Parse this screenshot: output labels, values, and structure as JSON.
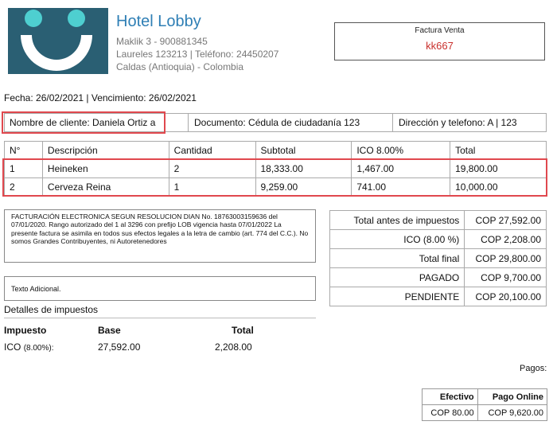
{
  "hotel": {
    "name": "Hotel Lobby",
    "address_line1": "Maklik 3 - 900881345",
    "address_line2": "Laureles 123213 | Teléfono: 24450207",
    "address_line3": "Caldas (Antioquia) - Colombia"
  },
  "invoice": {
    "label": "Factura Venta",
    "number": "kk667"
  },
  "dates": "Fecha: 26/02/2021 | Vencimiento: 26/02/2021",
  "client": {
    "name": "Nombre de cliente: Daniela Ortiz a",
    "document": "Documento: Cédula de ciudadanía 123",
    "address": "Dirección y telefono: A | 123"
  },
  "items": {
    "headers": [
      "N°",
      "Descripción",
      "Cantidad",
      "Subtotal",
      "ICO 8.00%",
      "Total"
    ],
    "rows": [
      [
        "1",
        "Heineken",
        "2",
        "18,333.00",
        "1,467.00",
        "19,800.00"
      ],
      [
        "2",
        "Cerveza Reina",
        "1",
        "9,259.00",
        "741.00",
        "10,000.00"
      ]
    ]
  },
  "legal_text": "FACTURACIÓN ELECTRONICA SEGUN RESOLUCION DIAN No. 18763003159636 del 07/01/2020. Rango autorizado del 1 al 3296 con prefijo LOB vigencia hasta 07/01/2022 La presente factura se asimila en todos sus efectos legales a la letra de cambio (art. 774 del C.C.). No somos Grandes Contribuyentes, ni Autoretenedores",
  "additional_text": "Texto Adicional.",
  "totals": [
    {
      "label": "Total antes de impuestos",
      "value": "COP 27,592.00"
    },
    {
      "label": "ICO (8.00 %)",
      "value": "COP 2,208.00"
    },
    {
      "label": "Total final",
      "value": "COP 29,800.00"
    },
    {
      "label": "PAGADO",
      "value": "COP 9,700.00"
    },
    {
      "label": "PENDIENTE",
      "value": "COP 20,100.00"
    }
  ],
  "tax_details": {
    "title": "Detalles de impuestos",
    "headers": {
      "tax": "Impuesto",
      "base": "Base",
      "total": "Total"
    },
    "row": {
      "tax": "ICO",
      "rate": "(8.00%):",
      "base": "27,592.00",
      "total": "2,208.00"
    }
  },
  "payments": {
    "label": "Pagos:",
    "headers": [
      "Efectivo",
      "Pago Online"
    ],
    "values": [
      "COP 80.00",
      "COP 9,620.00"
    ]
  },
  "colors": {
    "brand": "#2f7fb5",
    "logo_bg": "#2a5f73",
    "logo_face": "#4ecfd0",
    "invoice_number": "#c9302c",
    "highlight": "#e0484e"
  }
}
